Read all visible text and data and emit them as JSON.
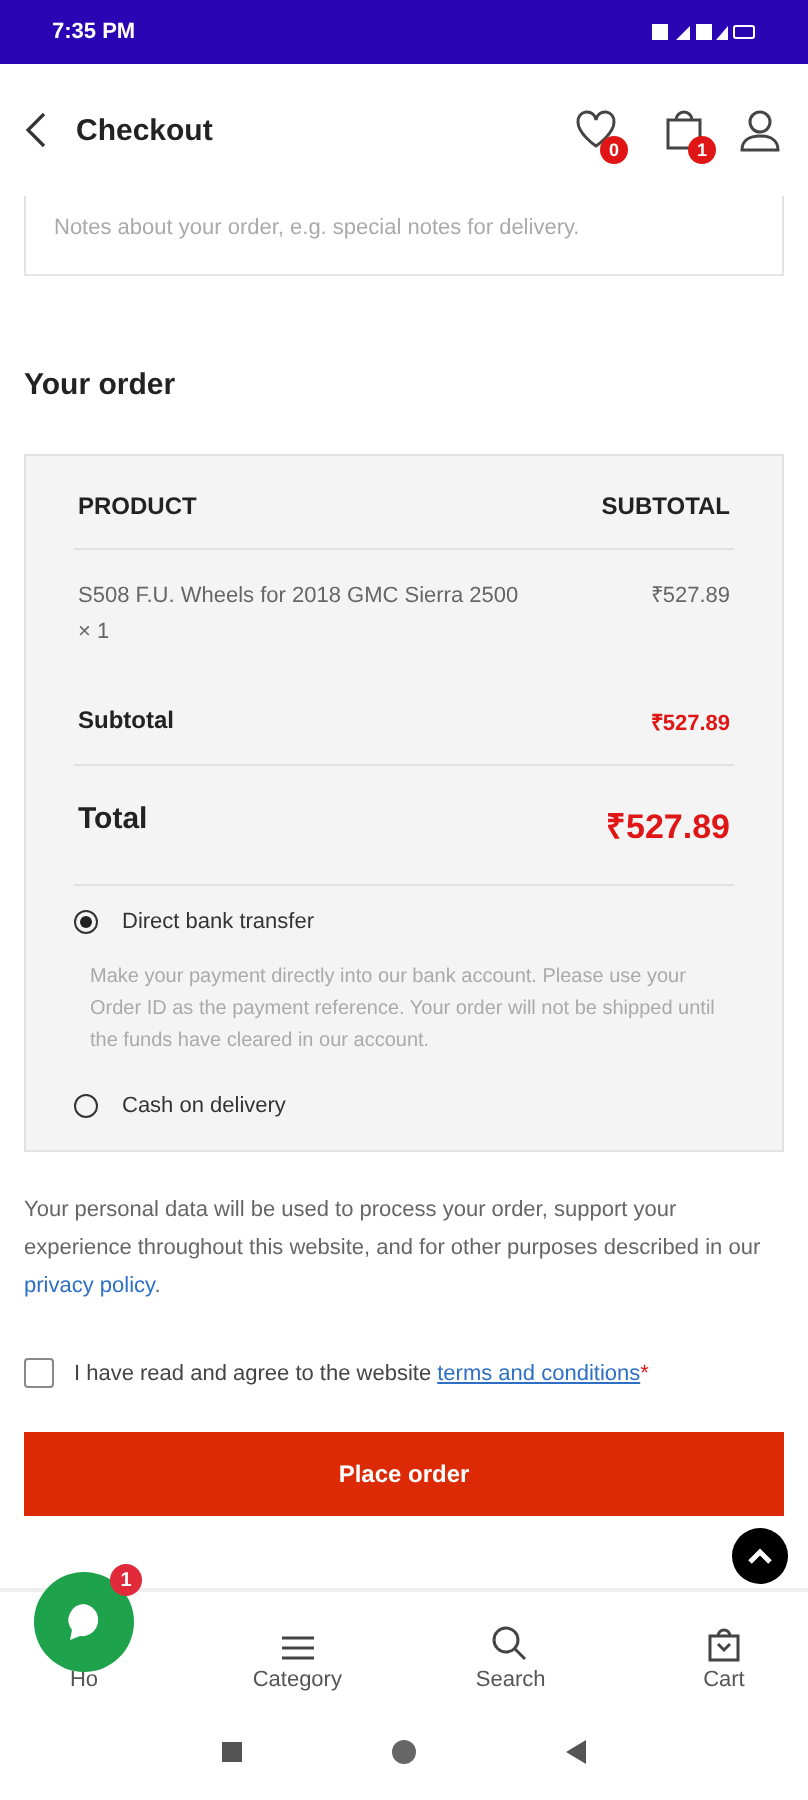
{
  "status_bar": {
    "time": "7:35 PM"
  },
  "header": {
    "title": "Checkout",
    "wishlist_count": "0",
    "cart_count": "1"
  },
  "notes": {
    "placeholder": "Notes about your order, e.g. special notes for delivery."
  },
  "order": {
    "heading": "Your order",
    "columns": [
      "PRODUCT",
      "SUBTOTAL"
    ],
    "items": [
      {
        "name": "S508 F.U. Wheels for 2018 GMC Sierra 2500",
        "qty": "× 1",
        "price": "₹527.89"
      }
    ],
    "subtotal_label": "Subtotal",
    "subtotal": "₹527.89",
    "total_label": "Total",
    "total": "₹527.89",
    "payments": [
      {
        "label": "Direct bank transfer",
        "selected": true,
        "description": "Make your payment directly into our bank account. Please use your Order ID as the payment reference. Your order will not be shipped until the funds have cleared in our account."
      },
      {
        "label": "Cash on delivery",
        "selected": false
      }
    ]
  },
  "privacy": {
    "text": "Your personal data will be used to process your order, support your experience throughout this website, and for other purposes described in our ",
    "link": "privacy policy",
    "end": "."
  },
  "terms": {
    "checked": false,
    "text": "I have read and agree to the website ",
    "link": "terms and conditions",
    "required": "*"
  },
  "place_order": "Place order",
  "chat": {
    "badge": "1"
  },
  "nav": [
    {
      "kind": "home",
      "label": "Ho"
    },
    {
      "kind": "category",
      "label": "Category"
    },
    {
      "kind": "search",
      "label": "Search"
    },
    {
      "kind": "cart",
      "label": "Cart"
    }
  ]
}
